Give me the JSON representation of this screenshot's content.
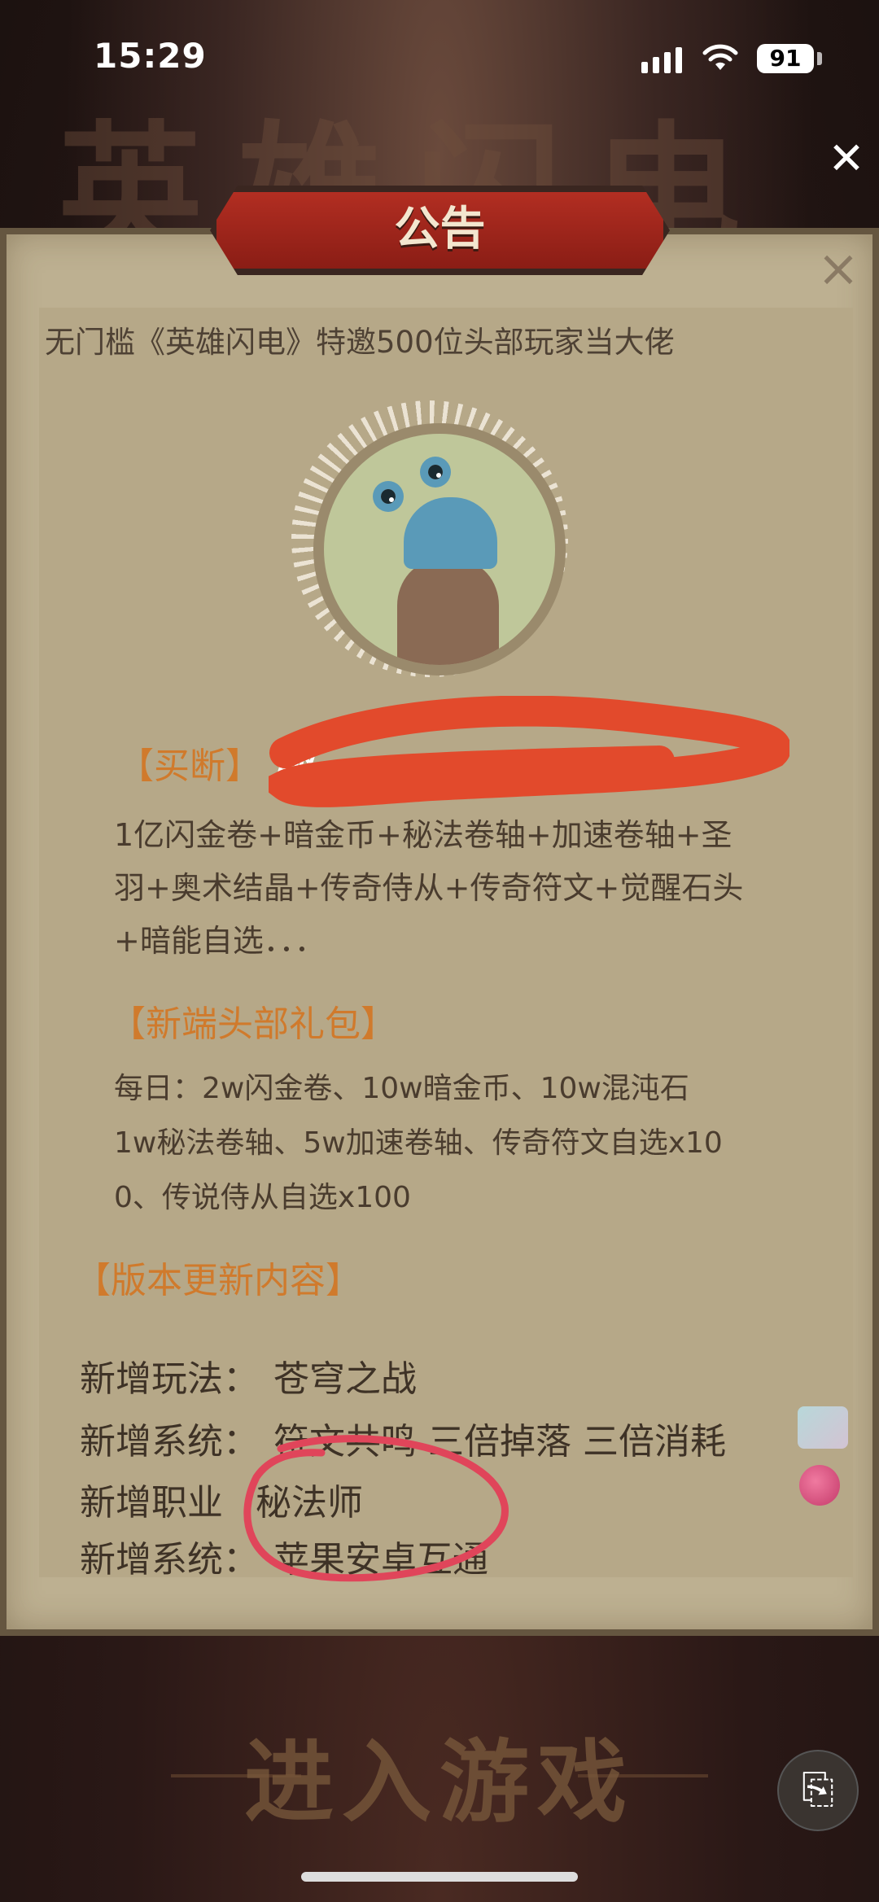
{
  "status_bar": {
    "time": "15:29",
    "battery": "91"
  },
  "modal": {
    "title": "公告",
    "headline": "无门槛《英雄闪电》特邀500位头部玩家当大佬",
    "buyout": {
      "title": "【买断】",
      "name_partial": "鹏",
      "lines": [
        "1亿闪金卷+暗金币+秘法卷轴+加速卷轴+圣",
        "羽+奥术结晶+传奇侍从+传奇符文+觉醒石头",
        "+暗能自选．．．"
      ]
    },
    "gift": {
      "title": "【新端头部礼包】",
      "lines": [
        "每日：2w闪金卷、10w暗金币、10w混沌石",
        "1w秘法卷轴、5w加速卷轴、传奇符文自选x10",
        "0、传说侍从自选x100"
      ]
    },
    "updates": {
      "title": "【版本更新内容】",
      "items": [
        {
          "key": "新增玩法：",
          "value": "苍穹之战"
        },
        {
          "key": "新增系统：",
          "value": "符文共鸣 三倍掉落 三倍消耗"
        },
        {
          "key": "新增职业",
          "value": "秘法师"
        },
        {
          "key": "新增系统：",
          "value": "苹果安卓互通"
        }
      ]
    }
  },
  "background": {
    "game_title": "英雄闪电",
    "enter_button": "进入游戏"
  },
  "colors": {
    "section_orange": "#d07a2c",
    "banner_red": "#a62a1e",
    "panel": "#c9bb9a"
  }
}
